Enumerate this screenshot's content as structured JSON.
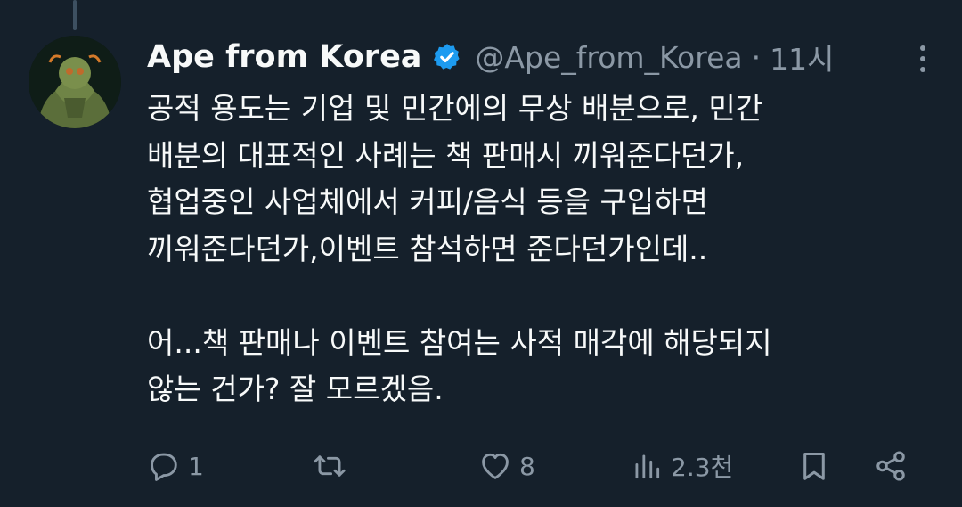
{
  "tweet": {
    "author_name": "Ape from Korea",
    "handle": "@Ape_from_Korea",
    "separator": "·",
    "time": "11시",
    "verified_color": "#1d9bf0",
    "body_lines": [
      "공적 용도는 기업 및 민간에의 무상 배분으로, 민간",
      "배분의 대표적인 사례는 책 판매시 끼워준다던가,",
      "협업중인 사업체에서 커피/음식 등을 구입하면",
      "끼워준다던가,이벤트 참석하면 준다던가인데..",
      "",
      "어...책 판매나 이벤트 참여는 사적 매각에 해당되지",
      "않는 건가? 잘 모르겠음."
    ]
  },
  "actions": {
    "reply": {
      "icon": "reply-icon",
      "count": "1"
    },
    "retweet": {
      "icon": "retweet-icon",
      "count": ""
    },
    "like": {
      "icon": "heart-icon",
      "count": "8"
    },
    "views": {
      "icon": "views-icon",
      "count": "2.3천"
    },
    "bookmark": {
      "icon": "bookmark-icon"
    },
    "share": {
      "icon": "share-icon"
    }
  },
  "colors": {
    "background": "#15202b",
    "text": "#f7f9f9",
    "muted": "#8b98a5",
    "accent": "#1d9bf0"
  }
}
